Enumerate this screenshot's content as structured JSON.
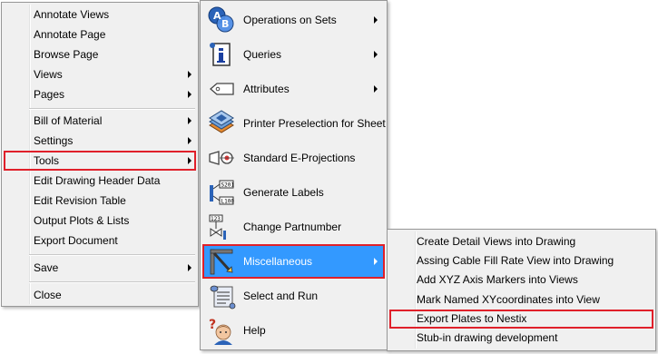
{
  "menu1": {
    "items": [
      {
        "label": "Annotate Views",
        "submenu": false
      },
      {
        "label": "Annotate Page",
        "submenu": false
      },
      {
        "label": "Browse Page",
        "submenu": false
      },
      {
        "label": "Views",
        "submenu": true
      },
      {
        "label": "Pages",
        "submenu": true
      },
      {
        "label": "Bill of Material",
        "submenu": true
      },
      {
        "label": "Settings",
        "submenu": true
      },
      {
        "label": "Tools",
        "submenu": true,
        "outlined": true
      },
      {
        "label": "Edit Drawing Header Data",
        "submenu": false
      },
      {
        "label": "Edit Revision Table",
        "submenu": false
      },
      {
        "label": "Output Plots & Lists",
        "submenu": false
      },
      {
        "label": "Export Document",
        "submenu": false
      },
      {
        "label": "Save",
        "submenu": true
      },
      {
        "label": "Close",
        "submenu": false
      }
    ]
  },
  "menu2": {
    "items": [
      {
        "label": "Operations on Sets",
        "icon": "sets-ab-icon",
        "submenu": true
      },
      {
        "label": "Queries",
        "icon": "query-info-icon",
        "submenu": true
      },
      {
        "label": "Attributes",
        "icon": "tag-icon",
        "submenu": true
      },
      {
        "label": "Printer Preselection for Sheet",
        "icon": "printer-stack-icon",
        "submenu": false
      },
      {
        "label": "Standard E-Projections",
        "icon": "projection-symbol-icon",
        "submenu": false
      },
      {
        "label": "Generate Labels",
        "icon": "labels-icon",
        "submenu": false
      },
      {
        "label": "Change Partnumber",
        "icon": "partnumber-icon",
        "submenu": false
      },
      {
        "label": "Miscellaneous",
        "icon": "miscellaneous-icon",
        "submenu": true,
        "highlighted": true,
        "outlined": true
      },
      {
        "label": "Select and Run",
        "icon": "script-scroll-icon",
        "submenu": false
      },
      {
        "label": "Help",
        "icon": "help-person-icon",
        "submenu": false
      }
    ]
  },
  "menu3": {
    "items": [
      {
        "label": "Create Detail Views into Drawing"
      },
      {
        "label": "Assing Cable Fill Rate View into Drawing"
      },
      {
        "label": "Add XYZ Axis Markers into Views"
      },
      {
        "label": "Mark Named XYcoordinates into View"
      },
      {
        "label": "Export Plates to Nestix",
        "outlined": true
      },
      {
        "label": "Stub-in drawing development"
      }
    ]
  },
  "colors": {
    "menu_bg": "#f0f0f0",
    "highlight": "#3399ff",
    "outline_red": "#e0202a"
  }
}
